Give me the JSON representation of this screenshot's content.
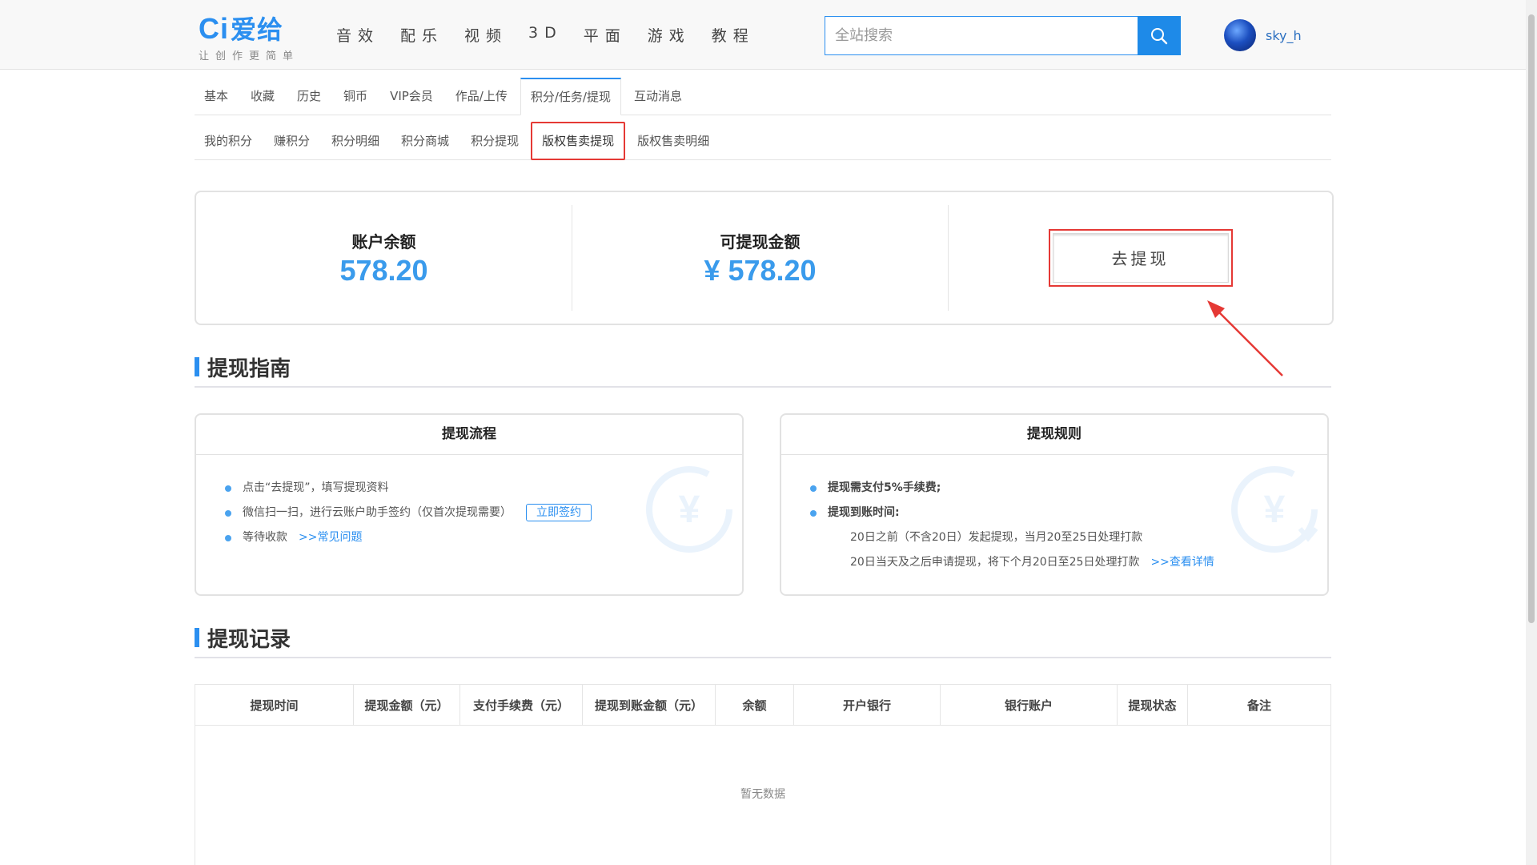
{
  "header": {
    "logo_text": "Ci",
    "logo_cn": "爱给",
    "tagline": "让创作更简单",
    "nav": [
      "音效",
      "配乐",
      "视频",
      "3D",
      "平面",
      "游戏",
      "教程"
    ],
    "search_placeholder": "全站搜索",
    "username": "sky_h"
  },
  "tabs_primary": [
    "基本",
    "收藏",
    "历史",
    "铜币",
    "VIP会员",
    "作品/上传",
    "积分/任务/提现",
    "互动消息"
  ],
  "tabs_primary_active": 6,
  "tabs_secondary": [
    "我的积分",
    "赚积分",
    "积分明细",
    "积分商城",
    "积分提现",
    "版权售卖提现",
    "版权售卖明细"
  ],
  "tabs_secondary_active": 5,
  "balance": {
    "account_label": "账户余额",
    "account_value": "578.20",
    "withdrawable_label": "可提现金额",
    "withdrawable_value": "¥ 578.20",
    "withdraw_button": "去提现"
  },
  "guide": {
    "title": "提现指南",
    "process": {
      "title": "提现流程",
      "step1": "点击“去提现”，填写提现资料",
      "step2": "微信扫一扫，进行云账户助手签约（仅首次提现需要）",
      "sign_button": "立即签约",
      "step3": "等待收款",
      "faq_link": ">>常见问题"
    },
    "rules": {
      "title": "提现规则",
      "rule1": "提现需支付5%手续费;",
      "rule2": "提现到账时间:",
      "rule2a": "20日之前（不含20日）发起提现，当月20至25日处理打款",
      "rule2b": "20日当天及之后申请提现，将下个月20日至25日处理打款",
      "detail_link": ">>查看详情"
    }
  },
  "records": {
    "title": "提现记录",
    "columns": [
      "提现时间",
      "提现金额（元）",
      "支付手续费（元）",
      "提现到账金额（元）",
      "余额",
      "开户银行",
      "银行账户",
      "提现状态",
      "备注"
    ],
    "empty_text": "暂无数据"
  },
  "colors": {
    "accent": "#2b8ff0",
    "highlight": "#e53935",
    "value": "#3a9bec"
  }
}
